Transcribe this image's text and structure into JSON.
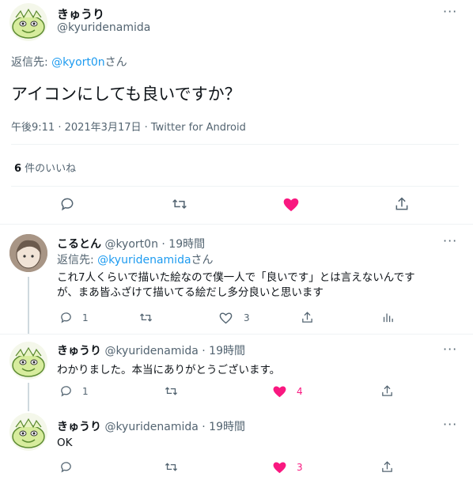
{
  "main_tweet": {
    "display_name": "きゅうり",
    "handle": "@kyuridenamida",
    "reply_to_prefix": "返信先: ",
    "reply_to_handle": "@kyort0n",
    "reply_to_suffix": "さん",
    "text": "アイコンにしても良いですか？",
    "timestamp": "午後9:11 · 2021年3月17日 · Twitter for Android",
    "likes_count": "6",
    "likes_label": " 件のいいね"
  },
  "replies": [
    {
      "display_name": "こるとん",
      "handle": "@kyort0n",
      "time": " · 19時間",
      "reply_to_prefix": "返信先: ",
      "reply_to_handle": "@kyuridenamida",
      "reply_to_suffix": "さん",
      "text_line1": "これ7人くらいで描いた絵なので僕一人で「良いです」とは言えないんです",
      "text_line2": "が、まあ皆ふざけて描いてる絵だし多分良いと思います",
      "reply_count": "1",
      "like_count": "3"
    },
    {
      "display_name": "きゅうり",
      "handle": "@kyuridenamida",
      "time": " · 19時間",
      "text": "わかりました。本当にありがとうございます。",
      "reply_count": "1",
      "like_count": "4"
    },
    {
      "display_name": "きゅうり",
      "handle": "@kyuridenamida",
      "time": " · 19時間",
      "text": "OK",
      "like_count": "3"
    }
  ],
  "colors": {
    "accent": "#1d9bf0",
    "like": "#f91880",
    "muted": "#536471"
  },
  "icons": [
    "more-icon",
    "reply-icon",
    "retweet-icon",
    "like-icon",
    "share-icon",
    "analytics-icon"
  ]
}
